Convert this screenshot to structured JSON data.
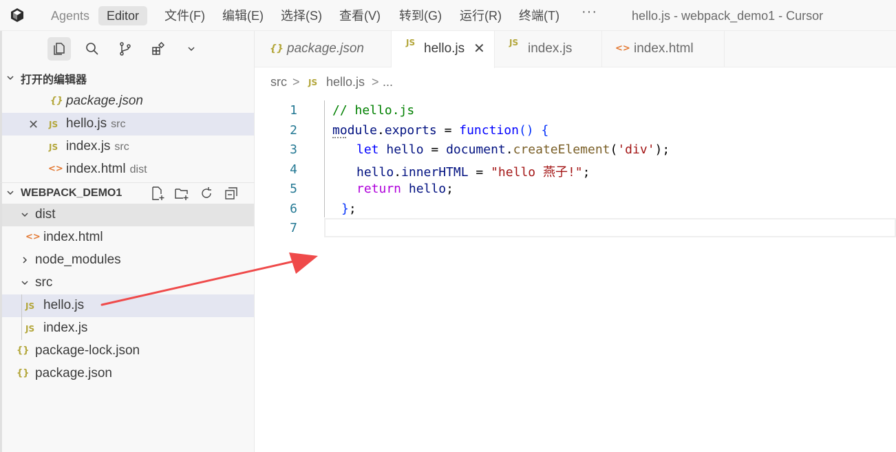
{
  "titlebar": {
    "agents_label": "Agents",
    "editor_label": "Editor",
    "menus": [
      "文件(F)",
      "编辑(E)",
      "选择(S)",
      "查看(V)",
      "转到(G)",
      "运行(R)",
      "终端(T)"
    ],
    "more": "···",
    "window_title": "hello.js - webpack_demo1 - Cursor"
  },
  "activity_icons": [
    "explorer-icon",
    "search-icon",
    "source-control-icon",
    "extensions-icon",
    "chevron-down-icon"
  ],
  "open_editors": {
    "header": "打开的编辑器",
    "items": [
      {
        "icon": "{}",
        "name": "package.json",
        "sub": ""
      },
      {
        "icon": "JS",
        "name": "hello.js",
        "sub": "src",
        "close": "✕"
      },
      {
        "icon": "JS",
        "name": "index.js",
        "sub": "src"
      },
      {
        "icon": "<>",
        "name": "index.html",
        "sub": "dist"
      }
    ]
  },
  "explorer": {
    "header": "WEBPACK_DEMO1",
    "items": [
      {
        "name": "dist"
      },
      {
        "icon": "<>",
        "name": "index.html"
      },
      {
        "name": "node_modules"
      },
      {
        "name": "src"
      },
      {
        "icon": "JS",
        "name": "hello.js"
      },
      {
        "icon": "JS",
        "name": "index.js"
      },
      {
        "icon": "{}",
        "name": "package-lock.json"
      },
      {
        "icon": "{}",
        "name": "package.json"
      }
    ]
  },
  "tabs": [
    {
      "icon": "{}",
      "label": "package.json"
    },
    {
      "icon": "JS",
      "label": "hello.js",
      "close": "✕"
    },
    {
      "icon": "JS",
      "label": "index.js"
    },
    {
      "icon": "<>",
      "label": "index.html"
    }
  ],
  "breadcrumb": {
    "folder": "src",
    "sep1": ">",
    "icon": "JS",
    "file": "hello.js",
    "sep2": ">",
    "more": "..."
  },
  "editor": {
    "line_numbers": [
      "1",
      "2",
      "3",
      "4",
      "5",
      "6",
      "7"
    ],
    "code": {
      "l1": "// hello.js",
      "l2_a": "module",
      "l2_b": ".",
      "l2_c": "exports",
      "l2_d": " = ",
      "l2_e": "function",
      "l2_f": "() {",
      "l3_a": "let",
      "l3_b": " hello",
      "l3_c": " = ",
      "l3_d": "document",
      "l3_e": ".",
      "l3_f": "createElement",
      "l3_g": "(",
      "l3_h": "'div'",
      "l3_i": ");",
      "l4_a": "hello",
      "l4_b": ".",
      "l4_c": "innerHTML",
      "l4_d": " = ",
      "l4_e": "\"hello 燕子!\"",
      "l4_f": ";",
      "l5_a": "return",
      "l5_b": " hello",
      "l5_c": ";",
      "l6_a": "}",
      "l6_b": ";"
    }
  },
  "colors": {
    "arrow": "#ef4a4a",
    "selection": "#e4e6f1",
    "js_icon": "#b3a63a",
    "html_icon": "#e37933"
  }
}
